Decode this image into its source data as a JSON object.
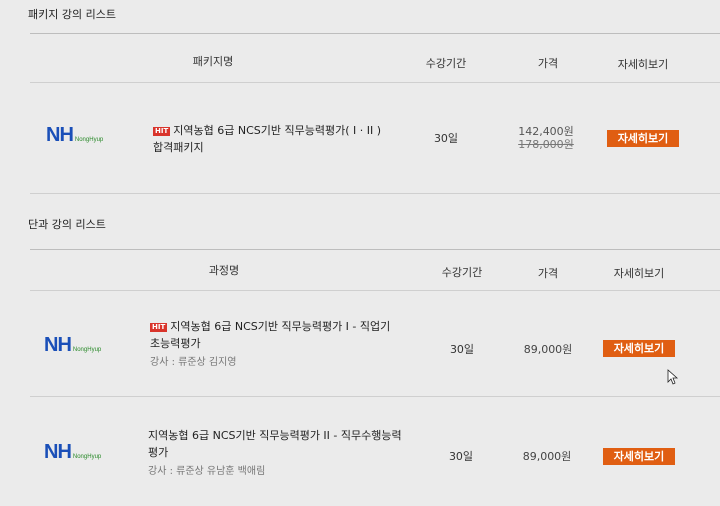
{
  "package_section": {
    "title": "패키지 강의 리스트",
    "headers": {
      "name": "패키지명",
      "period": "수강기간",
      "price": "가격",
      "detail": "자세히보기"
    },
    "rows": [
      {
        "logo": {
          "main": "NH",
          "sub": "NongHyup"
        },
        "badge": "HIT",
        "title_line1": "지역농협 6급 NCS기반 직무능력평가( I · II )",
        "title_line2": "합격패키지",
        "period": "30일",
        "price": "142,400원",
        "original_price": "178,000원",
        "button": "자세히보기"
      }
    ]
  },
  "single_section": {
    "title": "단과 강의 리스트",
    "headers": {
      "name": "과정명",
      "period": "수강기간",
      "price": "가격",
      "detail": "자세히보기"
    },
    "rows": [
      {
        "logo": {
          "main": "NH",
          "sub": "NongHyup"
        },
        "badge": "HIT",
        "title_line1": "지역농협 6급 NCS기반 직무능력평가 Ⅰ - 직업기",
        "title_line2": "초능력평가",
        "instructor": "강사 : 류준상 김지영",
        "period": "30일",
        "price": "89,000원",
        "button": "자세히보기"
      },
      {
        "logo": {
          "main": "NH",
          "sub": "NongHyup"
        },
        "title_line1": "지역농협 6급 NCS기반 직무능력평가 II - 직무수행능력",
        "title_line2": "평가",
        "instructor": "강사 : 류준상 유남훈 백애림",
        "period": "30일",
        "price": "89,000원",
        "button": "자세히보기"
      }
    ]
  },
  "colors": {
    "accent": "#e05e12",
    "hit_badge": "#d9342b",
    "nh_blue": "#1a4fb8",
    "nh_green": "#2a8a2a"
  }
}
